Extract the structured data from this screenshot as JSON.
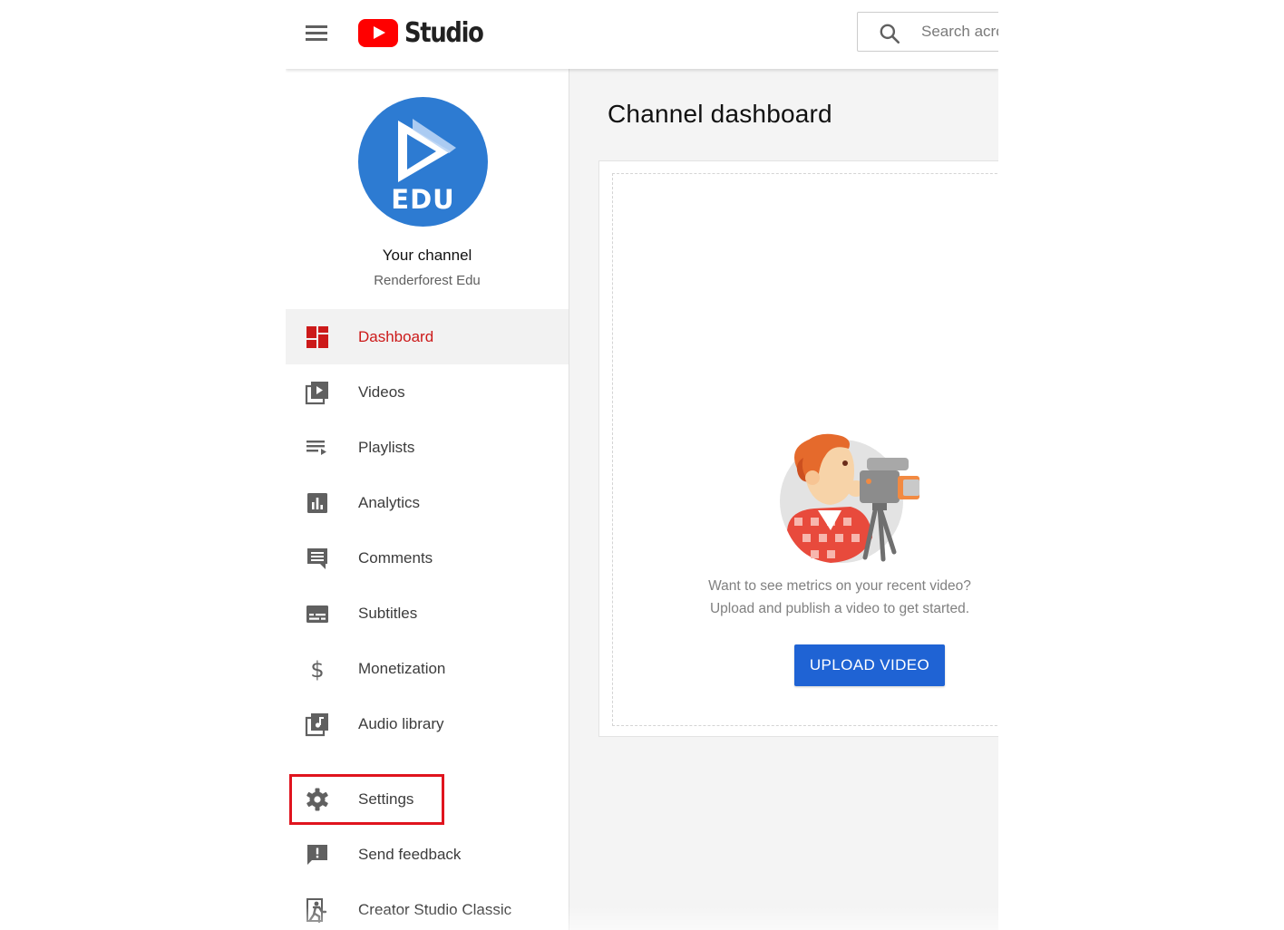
{
  "header": {
    "menu_icon": "hamburger-menu-icon",
    "logo_text": "Studio",
    "search_placeholder": "Search across your channel"
  },
  "sidebar": {
    "channel_title": "Your channel",
    "channel_name": "Renderforest Edu",
    "avatar_text": "EDU",
    "items": [
      {
        "label": "Dashboard",
        "icon": "dashboard-icon",
        "active": true
      },
      {
        "label": "Videos",
        "icon": "videos-icon"
      },
      {
        "label": "Playlists",
        "icon": "playlists-icon"
      },
      {
        "label": "Analytics",
        "icon": "analytics-icon"
      },
      {
        "label": "Comments",
        "icon": "comments-icon"
      },
      {
        "label": "Subtitles",
        "icon": "subtitles-icon"
      },
      {
        "label": "Monetization",
        "icon": "dollar-icon"
      },
      {
        "label": "Audio library",
        "icon": "audio-library-icon"
      },
      {
        "label": "Settings",
        "icon": "gear-icon",
        "highlighted": true
      },
      {
        "label": "Send feedback",
        "icon": "feedback-icon"
      },
      {
        "label": "Creator Studio Classic",
        "icon": "exit-icon"
      }
    ]
  },
  "main": {
    "title": "Channel dashboard",
    "empty_state": {
      "line1": "Want to see metrics on your recent video?",
      "line2": "Upload and publish a video to get started.",
      "button_label": "UPLOAD VIDEO"
    }
  },
  "colors": {
    "active_nav": "#cc1a1a",
    "upload_button": "#1f63d4",
    "highlight_box": "#e0141e",
    "brand_red": "#ff0000"
  }
}
